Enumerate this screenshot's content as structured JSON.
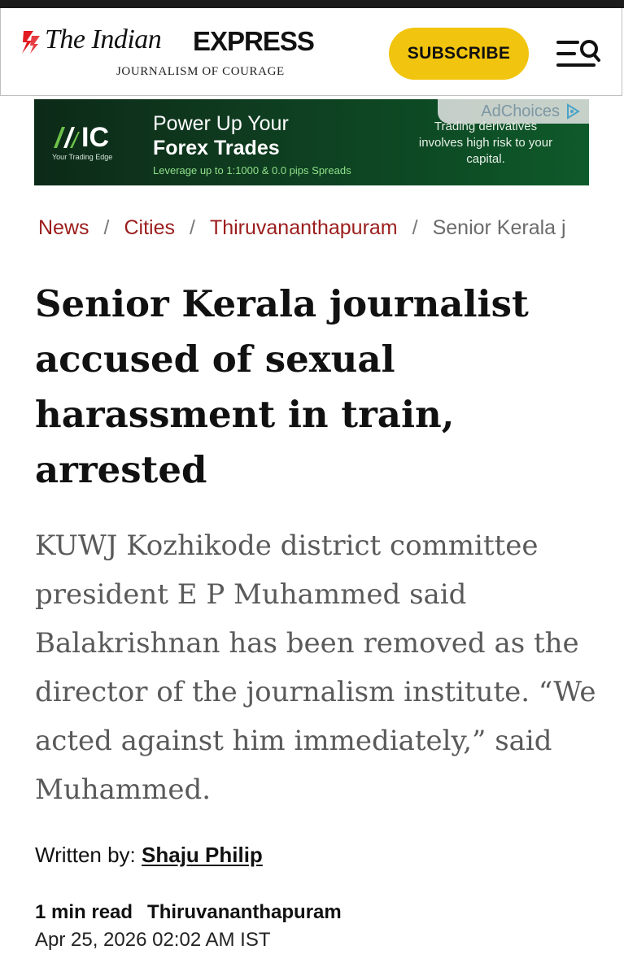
{
  "header": {
    "logo_the": "The Indian",
    "logo_express": "EXPRESS",
    "tagline": "JOURNALISM OF COURAGE",
    "subscribe_label": "SUBSCRIBE",
    "menu_icon": "menu-search-icon",
    "accent_color": "#f1c40f",
    "brand_red": "#e21b22"
  },
  "ad": {
    "logo": "IC",
    "logo_sub": "Your Trading Edge",
    "headline_line1": "Power Up Your",
    "headline_line2": "Forex Trades",
    "sub": "Leverage up to 1:1000 & 0.0 pips Spreads",
    "risk": "Trading derivatives involves high risk to your capital.",
    "adchoices": "AdChoices"
  },
  "breadcrumb": {
    "items": [
      "News",
      "Cities",
      "Thiruvananthapuram"
    ],
    "current": "Senior Kerala j",
    "separator": "/",
    "link_color": "#9b1c1c"
  },
  "article": {
    "title": "Senior Kerala journalist accused of sexual harassment in train, arrested",
    "dek": "KUWJ Kozhikode district committee president E P Muhammed said Balakrishnan has been removed as the director of the journalism institute. “We acted against him immediately,” said Muhammed.",
    "byline_label": "Written by:",
    "author": "Shaju Philip",
    "read_time": "1 min read",
    "location": "Thiruvananthapuram",
    "date": "Apr 25, 2026 02:02 AM IST"
  }
}
